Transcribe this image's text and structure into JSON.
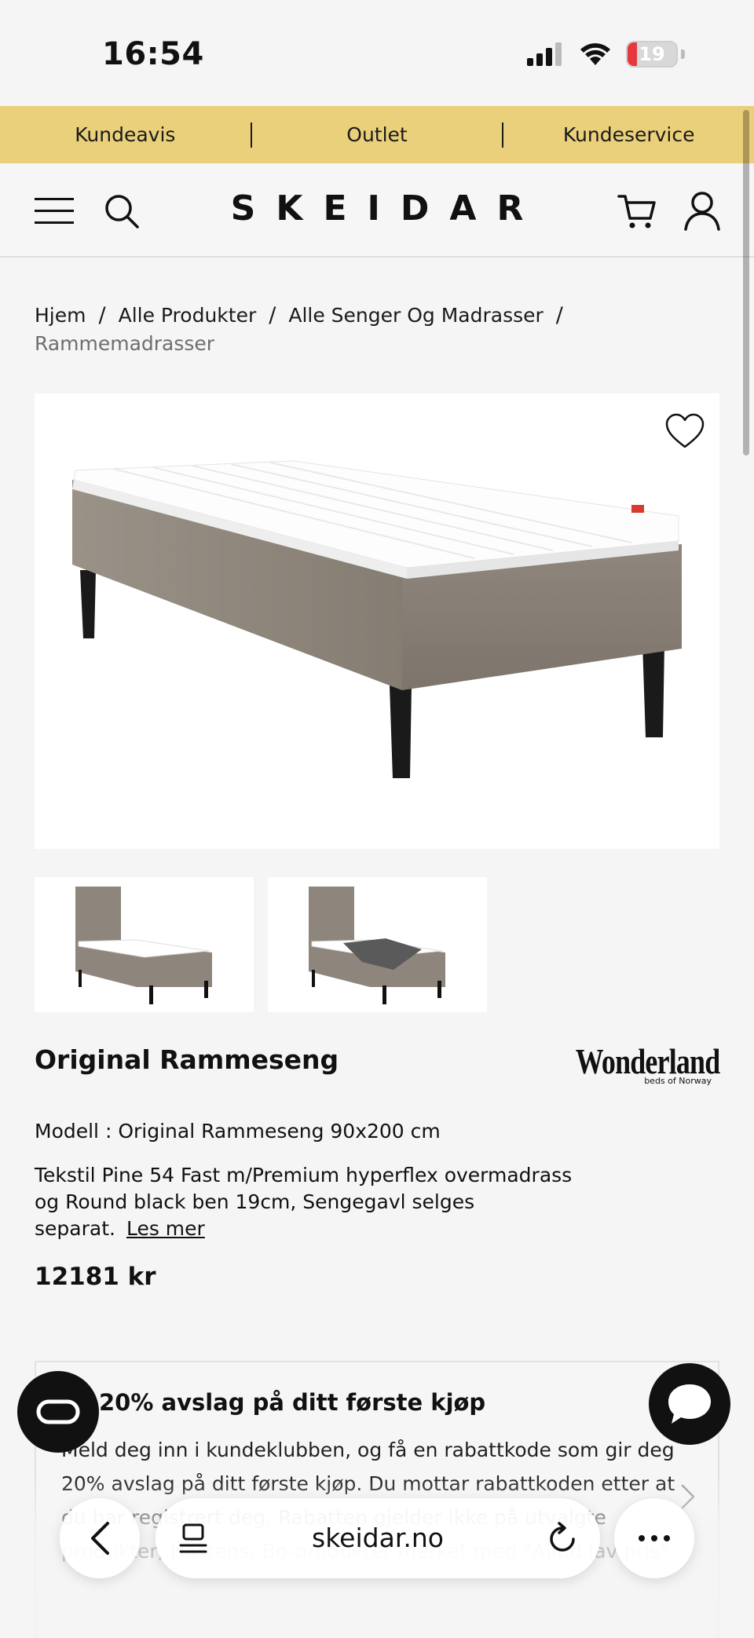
{
  "status": {
    "time": "16:54",
    "battery": "19",
    "battery_level": 0.19
  },
  "promo_bar": {
    "items": [
      "Kundeavis",
      "Outlet",
      "Kundeservice"
    ]
  },
  "header": {
    "logo": "SKEIDAR"
  },
  "breadcrumb": {
    "items": [
      "Hjem",
      "Alle Produkter",
      "Alle Senger Og Madrasser"
    ],
    "current": "Rammemadrasser"
  },
  "product": {
    "title": "Original Rammeseng",
    "brand": "Wonderland",
    "brand_sub": "beds of Norway",
    "model": "Modell : Original Rammeseng 90x200 cm",
    "description": "Tekstil Pine 54 Fast m/Premium hyperflex overmadrass og Round black ben 19cm, Sengegavl selges separat.",
    "read_more": "Les mer",
    "price": "12181 kr"
  },
  "promo_card": {
    "title": "20% avslag på ditt første kjøp",
    "text": "Meld deg inn i kundeklubben, og få en rabattkode som gir deg 20% avslag på ditt første kjøp. Du mottar rabattkoden etter at du har registrert deg. Rabatten gjelder ikke på utvalgte produkter, Hästens, Bo-produkter merket med \"Alltid lav pris\"."
  },
  "browser": {
    "url": "skeidar.no"
  },
  "icons": {
    "menu": "hamburger-menu-icon",
    "search": "search-icon",
    "cart": "cart-icon",
    "user": "user-icon",
    "favorite": "heart-icon",
    "chat": "chat-bubble-icon",
    "back": "chevron-left-icon",
    "tabs": "tabs-icon",
    "reload": "reload-icon",
    "more": "more-icon"
  },
  "colors": {
    "promo_bar": "#ead07a",
    "battery_low": "#e5393d",
    "accent": "#111111"
  }
}
